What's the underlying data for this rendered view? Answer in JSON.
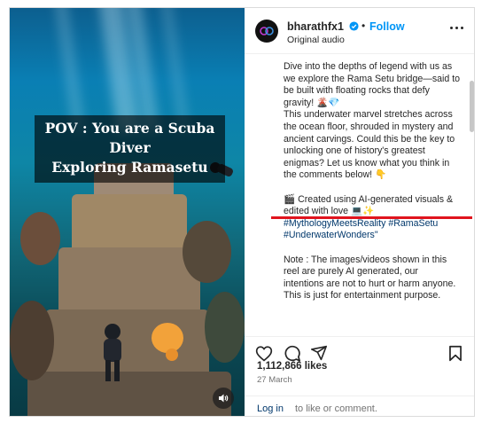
{
  "media": {
    "overlay_title_line1": "POV : You are a Scuba Diver",
    "overlay_title_line2": "Exploring Ramasetu"
  },
  "header": {
    "username": "bharathfx1",
    "separator": "•",
    "follow_label": "Follow",
    "subtitle": "Original audio"
  },
  "caption": {
    "p1": "Dive into the depths of legend with us as we explore the Rama Setu bridge—said to be built with floating rocks that defy gravity! 🌋💎",
    "p2": "This underwater marvel stretches across the ocean floor, shrouded in mystery and ancient carvings. Could this be the key to unlocking one of history's greatest enigmas? Let us know what you think in the comments below! 👇",
    "p3": "🎬 Created using AI-generated visuals & edited with love 💻✨",
    "hashtags": "#MythologyMeetsReality #RamaSetu #UnderwaterWonders\"",
    "note": "Note : The images/videos shown in this reel are purely AI generated, our intentions are not to hurt or harm anyone. This is just for entertainment purpose."
  },
  "stats": {
    "likes": "1,112,866 likes",
    "date": "27 March"
  },
  "comment": {
    "login_label": "Log in",
    "rest_label": "to like or comment."
  },
  "icons": {
    "avatar": "avatar-logo-icon",
    "verified": "verified-badge-icon",
    "more": "more-options-icon",
    "like": "heart-icon",
    "comment": "comment-icon",
    "share": "share-icon",
    "save": "bookmark-icon",
    "sound": "speaker-icon"
  },
  "colors": {
    "accent": "#0095f6",
    "annotation_underline": "#e0141e",
    "link": "#00376b"
  }
}
